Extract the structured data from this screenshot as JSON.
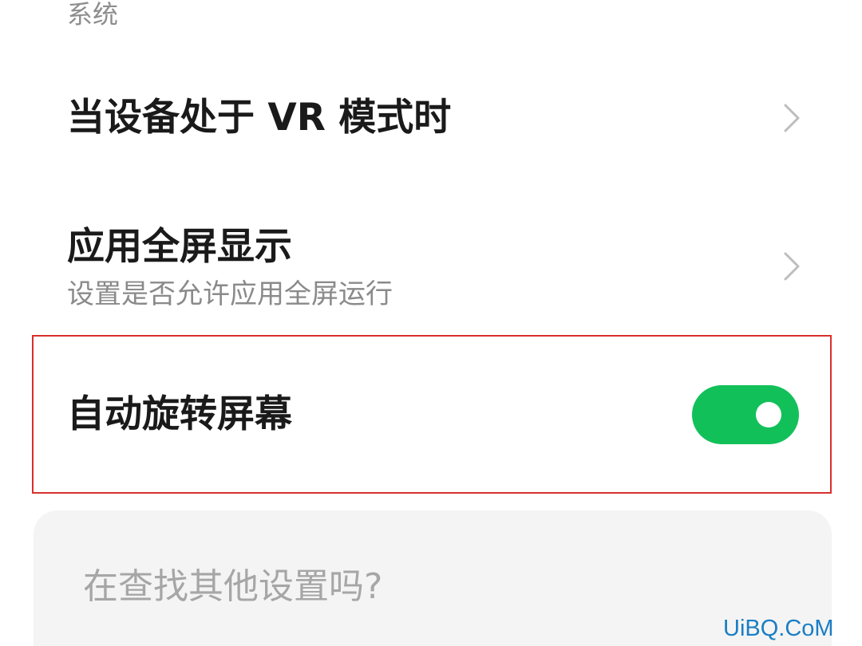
{
  "section": {
    "header": "系统"
  },
  "rows": {
    "vr_mode": {
      "title": "当设备处于 VR 模式时"
    },
    "fullscreen": {
      "title": "应用全屏显示",
      "subtitle": "设置是否允许应用全屏运行"
    },
    "auto_rotate": {
      "title": "自动旋转屏幕",
      "enabled": true
    }
  },
  "search_card": {
    "prompt": "在查找其他设置吗?"
  },
  "watermark": "UiBQ.CoM",
  "colors": {
    "toggle_on": "#12c05a",
    "highlight_border": "#d9302c",
    "watermark": "#1a7ec4"
  },
  "icons": {
    "chevron": "chevron-right-icon"
  }
}
